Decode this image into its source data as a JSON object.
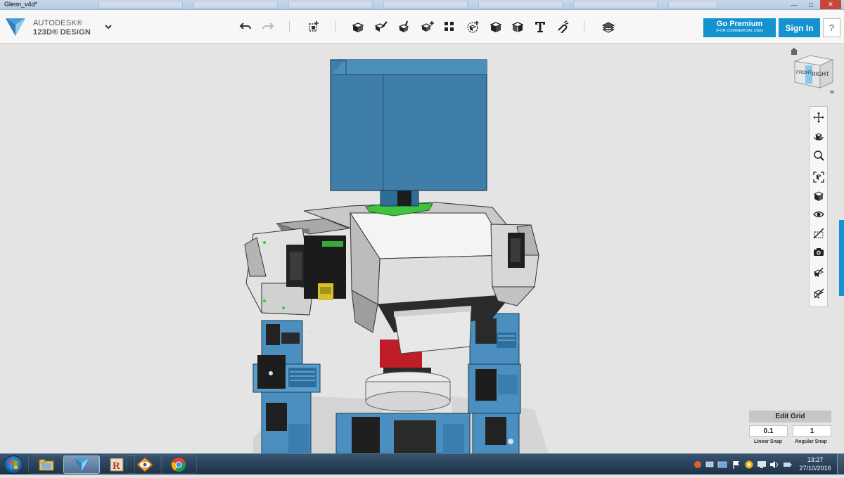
{
  "window": {
    "title": "Glenn_v4d*",
    "controls": [
      "minimize-icon",
      "maximize-icon",
      "close-icon"
    ]
  },
  "brand": {
    "line1": "AUTODESK®",
    "line2": "123D® DESIGN",
    "logo_icon": "autodesk-123d-logo-icon",
    "menu_icon": "chevron-down-icon"
  },
  "toolbar": {
    "history": [
      "undo-icon",
      "redo-icon"
    ],
    "tools": [
      "transform-icon",
      "primitives-icon",
      "sketch-icon",
      "construct-icon",
      "modify-icon",
      "pattern-icon",
      "group-icon",
      "combine-icon",
      "measure-icon",
      "text-icon",
      "snap-icon",
      "materials-icon"
    ],
    "go_premium_label": "Go Premium",
    "go_premium_sub": "(FOR COMMERCIAL USE)",
    "sign_in_label": "Sign In",
    "help_label": "?"
  },
  "view_cube": {
    "front_label": "FRONT",
    "right_label": "RIGHT",
    "home_icon": "home-icon"
  },
  "nav_tools": [
    "pan-icon",
    "orbit-icon",
    "zoom-icon",
    "fit-icon",
    "view-mode-icon",
    "visibility-icon",
    "hide-icon",
    "camera-icon",
    "materials-visibility-icon",
    "outline-icon"
  ],
  "edit_grid": {
    "title": "Edit Grid",
    "linear_snap_value": "0.1",
    "angular_snap_value": "1",
    "linear_snap_label": "Linear Snap",
    "angular_snap_label": "Angular Snap"
  },
  "taskbar": {
    "apps": [
      "windows-explorer-icon",
      "123d-design-icon",
      "rhino-r-icon",
      "eye-app-icon",
      "chrome-icon"
    ],
    "active_app": "123d-design-icon",
    "clock_time": "13:27",
    "clock_date": "27/10/2016"
  },
  "colors": {
    "accent": "#1593d0",
    "robot_head": "#3f7ea8",
    "servo_blue": "#4a8fc0",
    "green_part": "#3ec43e",
    "red_part": "#c0202a"
  }
}
